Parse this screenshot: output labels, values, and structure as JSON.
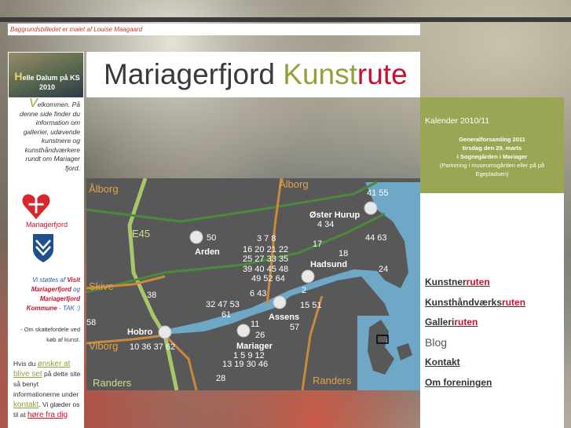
{
  "credit": "Baggrundsbilledet er malet af Louise Maagaard",
  "header": {
    "title_a": "Mariagerfjord ",
    "title_b": "Kunst",
    "title_c": "rute"
  },
  "sidebar": {
    "profile_first": "H",
    "profile_text": "elle Dalum på KS 2010",
    "welcome_first": "V",
    "welcome_text": "elkommen. På denne side finder du information om gallerier, udøvende kunstnere og kunsthåndværkere rundt om Mariager fjord.",
    "logo_label": "Mariagerfjord",
    "support_a": "Vi støttes af ",
    "support_b": "Visit Mariagerfjord",
    "support_c": " og ",
    "support_d": "Mariagerfjord Kommune",
    "support_e": " - TAK :)",
    "tax": "- Om skattefordele ved køb af kunst.",
    "interest_a": "Hvis du ",
    "interest_b": "ønsker at blive set",
    "interest_c": " på dette site så benyt informationerne under ",
    "interest_d": "kontakt",
    "interest_e": ". Vi glæder os til at ",
    "interest_f": "høre fra dig"
  },
  "calendar": {
    "title": "Kalender 2010/11",
    "line1": "Generalforsamling 2011",
    "line2": "tirsdag den 29. marts",
    "line3": "i Sognegården i Mariager",
    "line4": "(Parkering i museumsgården eller på på Egepladsen)"
  },
  "menu": {
    "kunstner_a": "Kunstner",
    "kunstner_b": "ruten",
    "haandvaerk_a": "Kunsthåndværks",
    "haandvaerk_b": "ruten",
    "galleri_a": "Galleri",
    "galleri_b": "ruten",
    "blog": "Blog",
    "kontakt": "Kontakt",
    "forening": "Om foreningen"
  },
  "map": {
    "road_labels": [
      "Ålborg",
      "Ålborg",
      "E45",
      "Skive",
      "Viborg",
      "Randers",
      "Randers"
    ],
    "towns": [
      "Øster Hurup",
      "Arden",
      "Hadsund",
      "Assens",
      "Hobro",
      "Mariager"
    ],
    "numbers": [
      "41 55",
      "4 34",
      "50",
      "3 7 8",
      "16 20 21 22",
      "25 27 33 35",
      "17",
      "18",
      "39 40 45 48",
      "49 52 64",
      "44 63",
      "24",
      "38",
      "6 43",
      "2",
      "32 47 53",
      "61",
      "15 51",
      "58",
      "57",
      "11",
      "26",
      "10 36 37 62",
      "1 5 9 12",
      "13 19 30 46",
      "28"
    ]
  }
}
